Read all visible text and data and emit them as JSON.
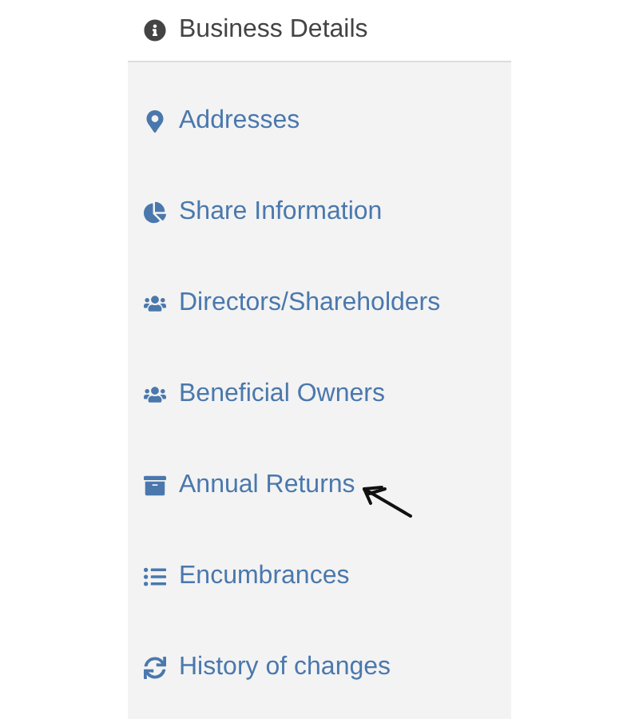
{
  "sidebar": {
    "items": [
      {
        "label": "Business Details",
        "selected": true
      },
      {
        "label": "Addresses",
        "selected": false
      },
      {
        "label": "Share Information",
        "selected": false
      },
      {
        "label": "Directors/Shareholders",
        "selected": false
      },
      {
        "label": "Beneficial Owners",
        "selected": false
      },
      {
        "label": "Annual Returns",
        "selected": false,
        "annotated": true
      },
      {
        "label": "Encumbrances",
        "selected": false
      },
      {
        "label": "History of changes",
        "selected": false
      }
    ]
  }
}
